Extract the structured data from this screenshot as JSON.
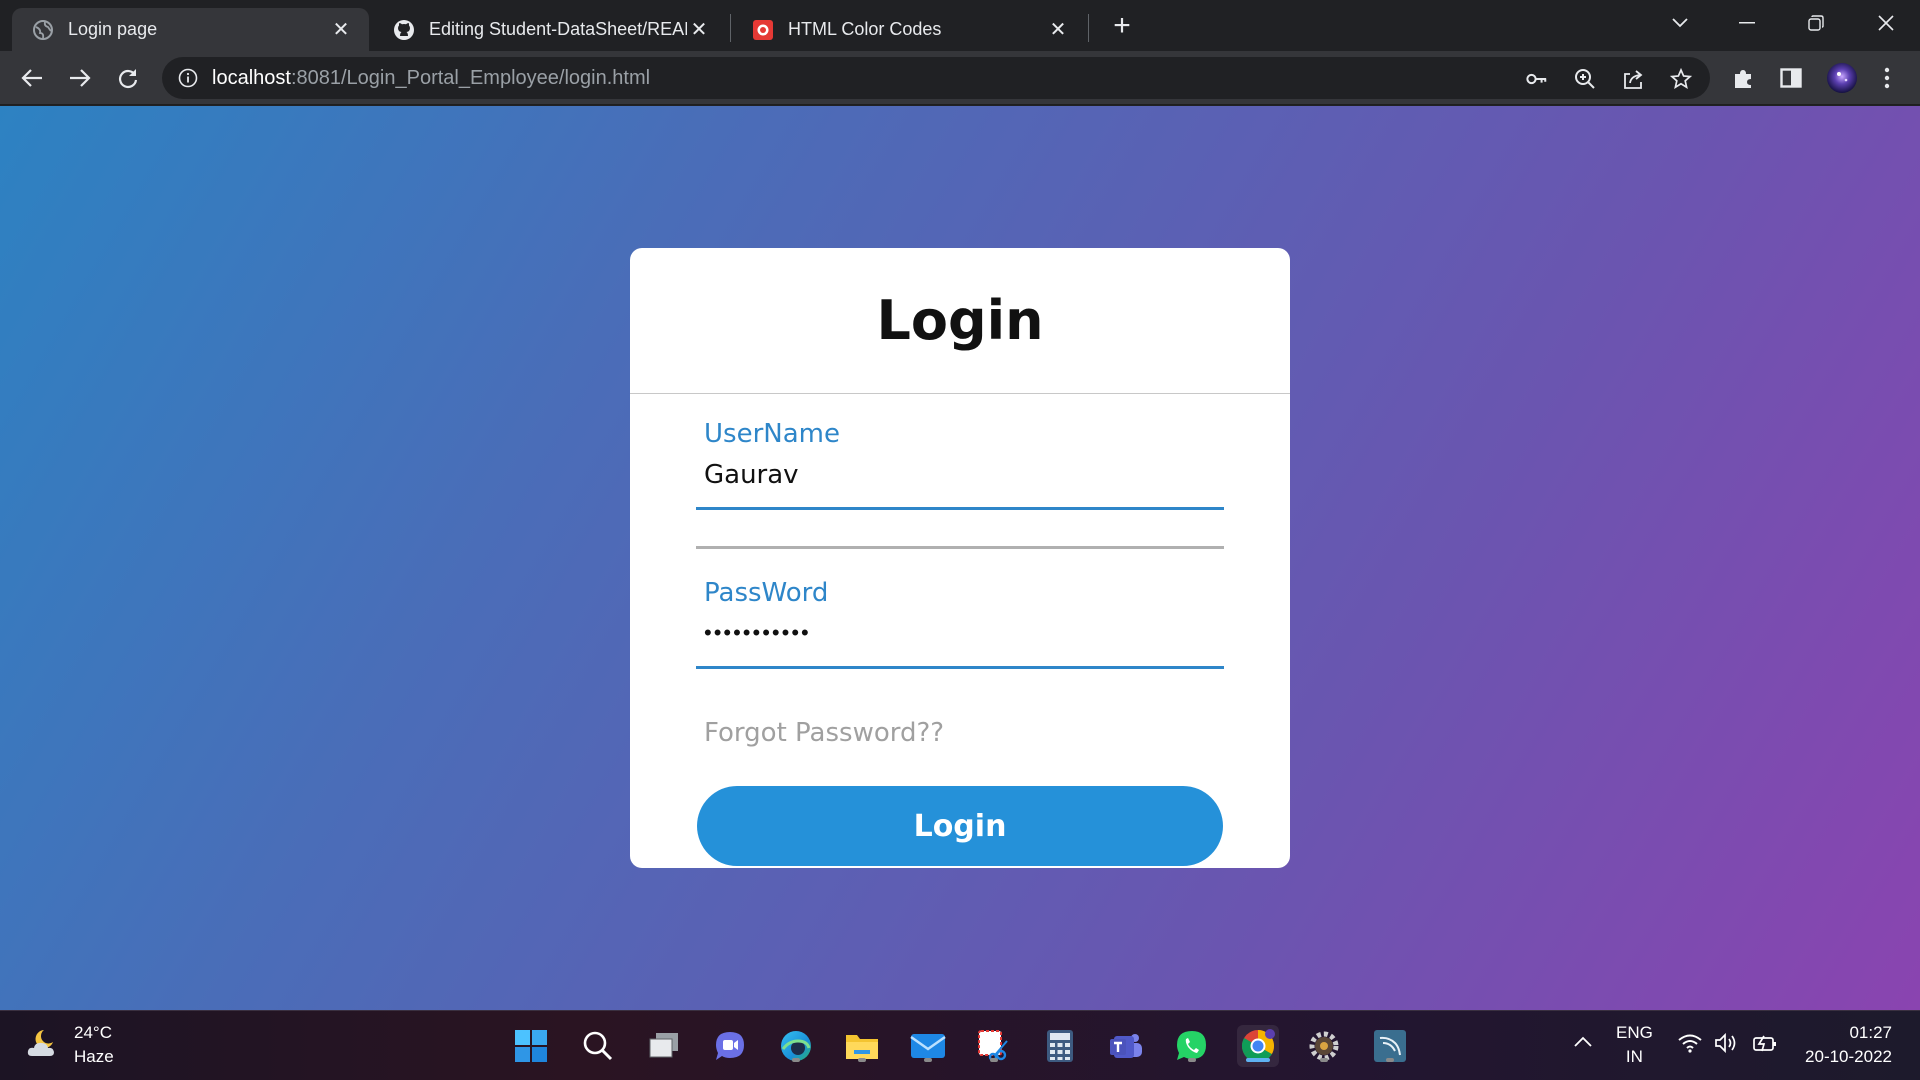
{
  "browser": {
    "tabs": [
      {
        "title": "Login page",
        "active": true
      },
      {
        "title": "Editing Student-DataSheet/README",
        "active": false
      },
      {
        "title": "HTML Color Codes",
        "active": false
      }
    ],
    "address": {
      "host": "localhost",
      "rest": ":8081/Login_Portal_Employee/login.html"
    }
  },
  "login_form": {
    "title": "Login",
    "username_label": "UserName",
    "username_value": "Gaurav",
    "password_label": "PassWord",
    "password_masked": "•••••••••••",
    "forgot_link": "Forgot Password??",
    "submit_label": "Login"
  },
  "taskbar": {
    "weather_temp": "24°C",
    "weather_desc": "Haze",
    "lang_top": "ENG",
    "lang_bottom": "IN",
    "time": "01:27",
    "date": "20-10-2022"
  },
  "colors": {
    "accent": "#2e86c9",
    "button": "#2591d9",
    "gradient_start": "#2d82c2",
    "gradient_end": "#8a44b0"
  }
}
